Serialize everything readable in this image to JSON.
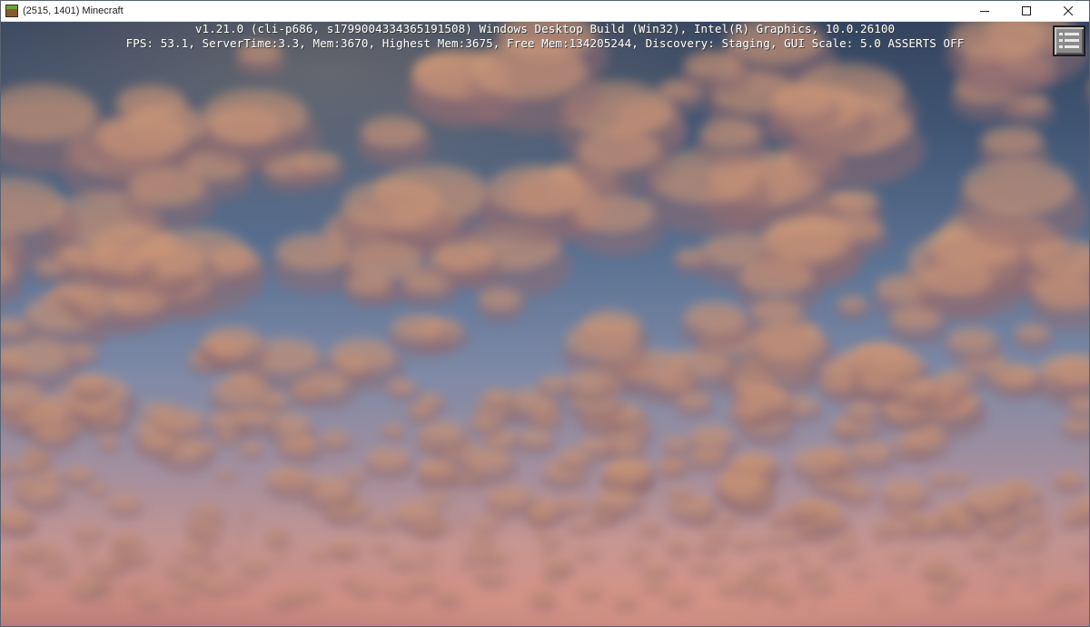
{
  "window": {
    "title": "(2515, 1401) Minecraft",
    "icon": "minecraft-grass-block-icon",
    "controls": [
      "minimize-icon",
      "maximize-icon",
      "close-icon"
    ]
  },
  "debug_overlay": {
    "line1": "v1.21.0 (cli-p686, s1799004334365191508) Windows Desktop Build (Win32), Intel(R) Graphics, 10.0.26100",
    "line2": "FPS: 53.1, ServerTime:3.3, Mem:3670, Highest Mem:3675, Free Mem:134205244, Discovery: Staging, GUI Scale: 5.0 ASSERTS OFF"
  },
  "hud": {
    "menu_button_icon": "menu-list-icon"
  },
  "colors": {
    "sky_top": "#34445e",
    "sky_horizon": "#c98a80",
    "cloud_lit": "#d9a079",
    "cloud_shadow": "#8f6c72",
    "text": "#ffffff"
  }
}
